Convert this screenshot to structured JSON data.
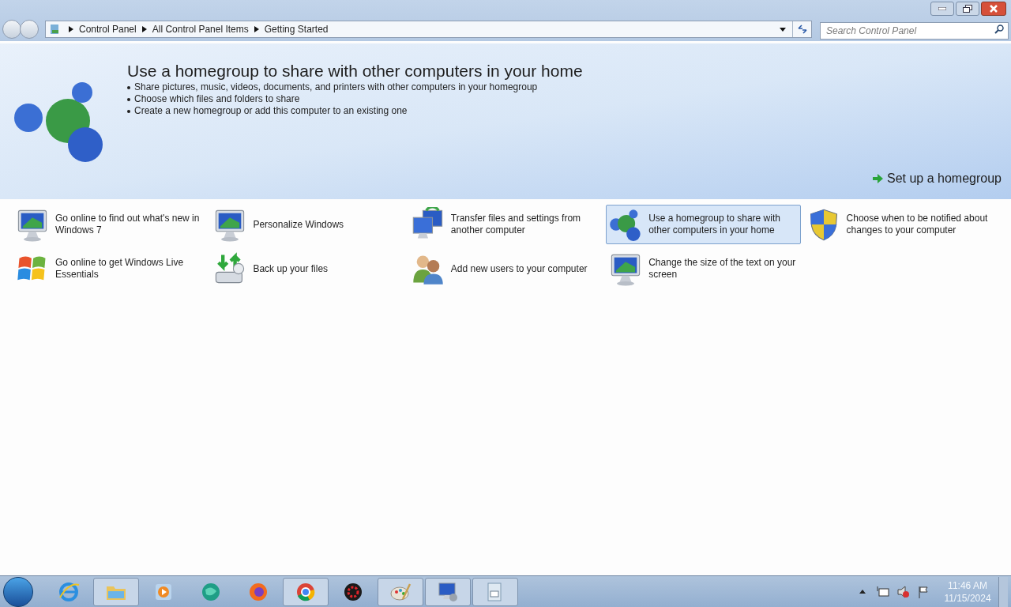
{
  "address_bar": {
    "breadcrumbs": [
      "Control Panel",
      "All Control Panel Items",
      "Getting Started"
    ]
  },
  "search": {
    "placeholder": "Search Control Panel"
  },
  "banner": {
    "title": "Use a homegroup to share with other computers in your home",
    "bullets": [
      "Share pictures, music, videos, documents, and printers with other computers in your homegroup",
      "Choose which files and folders to share",
      "Create a new homegroup or add this computer to an existing one"
    ],
    "action": "Set up a homegroup"
  },
  "tasks": [
    {
      "label": "Go online to find out what's new in Windows 7",
      "kind": "monitor",
      "selected": false
    },
    {
      "label": "Personalize Windows",
      "kind": "monitor",
      "selected": false
    },
    {
      "label": "Transfer files and settings from another computer",
      "kind": "computers",
      "selected": false
    },
    {
      "label": "Use a homegroup to share with other computers in your home",
      "kind": "spheres",
      "selected": true
    },
    {
      "label": "Choose when to be notified about changes to your computer",
      "kind": "shield",
      "selected": false
    },
    {
      "label": "Go online to get Windows Live Essentials",
      "kind": "flag",
      "selected": false
    },
    {
      "label": "Back up your files",
      "kind": "backup",
      "selected": false
    },
    {
      "label": "Add new users to your computer",
      "kind": "users",
      "selected": false
    },
    {
      "label": "Change the size of the text on your screen",
      "kind": "monitor",
      "selected": false
    }
  ],
  "taskbar": {
    "items": [
      {
        "kind": "browser",
        "running": false
      },
      {
        "kind": "folder",
        "running": true
      },
      {
        "kind": "media",
        "running": false
      },
      {
        "kind": "globe",
        "running": false
      },
      {
        "kind": "fox",
        "running": false
      },
      {
        "kind": "chrome",
        "running": true
      },
      {
        "kind": "gear",
        "running": false
      },
      {
        "kind": "paint",
        "running": true
      },
      {
        "kind": "monitor",
        "running": true
      },
      {
        "kind": "document",
        "running": true
      }
    ],
    "time": "11:46 AM",
    "date": "11/15/2024"
  }
}
